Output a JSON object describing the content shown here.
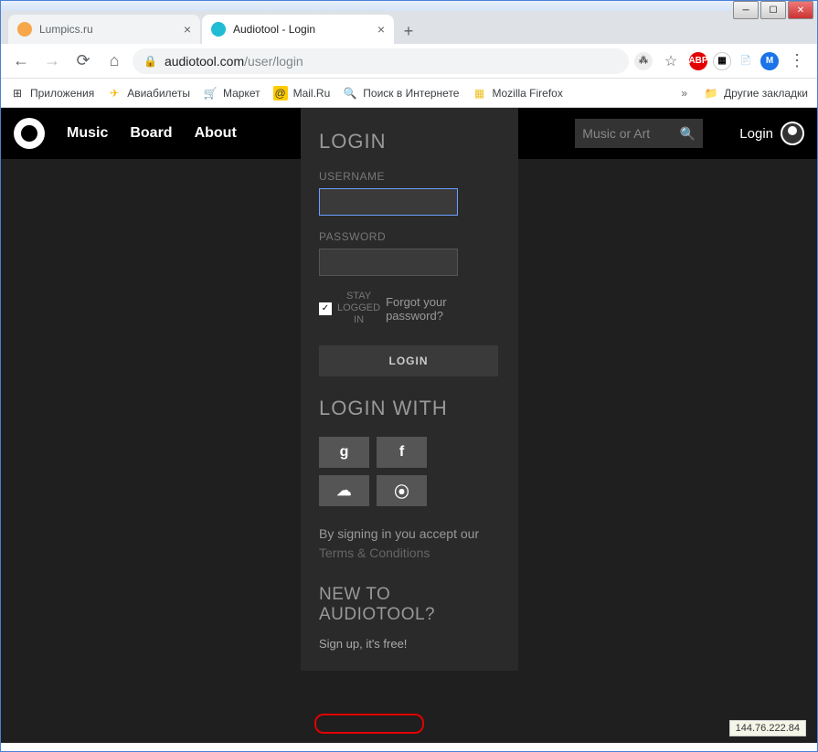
{
  "window": {
    "tabs": [
      {
        "title": "Lumpics.ru",
        "favicon_color": "#f7a64a",
        "active": false
      },
      {
        "title": "Audiotool - Login",
        "favicon_color": "#1fbcd3",
        "active": true
      }
    ]
  },
  "address_bar": {
    "host": "audiotool.com",
    "path": "/user/login"
  },
  "bookmarks": [
    {
      "icon": "⊞",
      "label": "Приложения",
      "color": "#5f6368"
    },
    {
      "icon": "✈",
      "label": "Авиабилеты",
      "color": "#f7b500"
    },
    {
      "icon": "🛒",
      "label": "Маркет",
      "color": "#ff6600"
    },
    {
      "icon": "@",
      "label": "Mail.Ru",
      "color": "#ffcc00"
    },
    {
      "icon": "🔍",
      "label": "Поиск в Интернете",
      "color": "#ff9900"
    },
    {
      "icon": "▦",
      "label": "Mozilla Firefox",
      "color": "#f0c020"
    }
  ],
  "bookmarks_overflow": "Другие закладки",
  "site": {
    "nav": [
      "Music",
      "Board",
      "About"
    ],
    "search_placeholder": "Music or Art",
    "login_link": "Login"
  },
  "login": {
    "title": "LOGIN",
    "username_label": "USERNAME",
    "password_label": "PASSWORD",
    "stay_logged": "STAY LOGGED IN",
    "forgot": "Forgot your password?",
    "button": "LOGIN",
    "login_with": "LOGIN WITH",
    "social": [
      "g",
      "f",
      "☁",
      "⦿"
    ],
    "terms_prefix": "By signing in you accept our ",
    "terms_link": "Terms & Conditions",
    "new_title": "NEW TO AUDIOTOOL?",
    "signup": "Sign up, it's free!"
  },
  "ip": "144.76.222.84"
}
